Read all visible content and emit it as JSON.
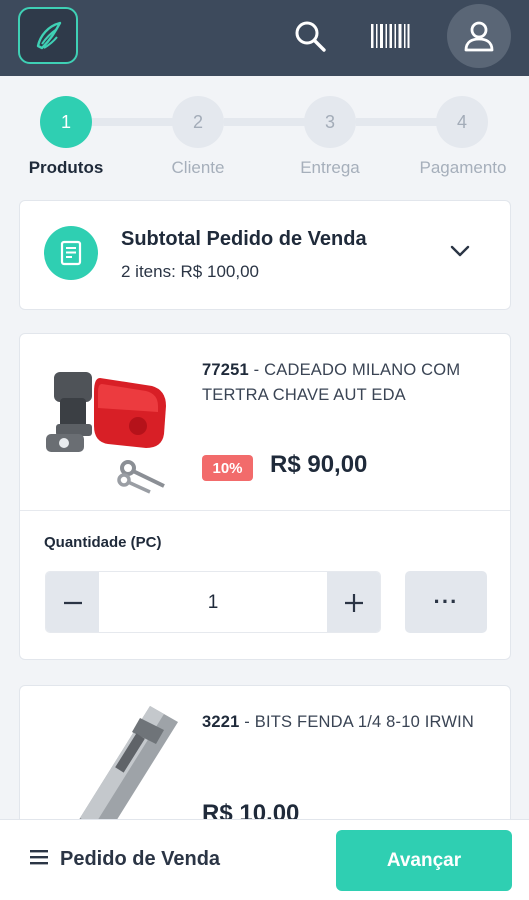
{
  "header": {
    "logo_icon": "wing-logo-icon",
    "search_icon": "search-icon",
    "barcode_icon": "barcode-icon",
    "user_icon": "user-icon"
  },
  "stepper": {
    "steps": [
      {
        "number": "1",
        "label": "Produtos",
        "active": true
      },
      {
        "number": "2",
        "label": "Cliente",
        "active": false
      },
      {
        "number": "3",
        "label": "Entrega",
        "active": false
      },
      {
        "number": "4",
        "label": "Pagamento",
        "active": false
      }
    ]
  },
  "subtotal": {
    "title": "Subtotal Pedido de Venda",
    "summary": "2 itens: R$ 100,00"
  },
  "products": [
    {
      "code": "77251",
      "separator": " - ",
      "name": "CADEADO MILANO COM TERTRA CHAVE AUT EDA",
      "discount": "10%",
      "price": "R$ 90,00",
      "quantity_label": "Quantidade (PC)",
      "quantity": "1",
      "more_label": "···"
    },
    {
      "code": "3221",
      "separator": " - ",
      "name": "BITS FENDA 1/4 8-10 IRWIN",
      "price": "R$ 10,00"
    }
  ],
  "footer": {
    "menu_label": "Pedido de Venda",
    "advance_label": "Avançar"
  },
  "colors": {
    "accent": "#2fcfb2",
    "header_bg": "#3d4a5c",
    "discount_bg": "#f26b6b"
  }
}
